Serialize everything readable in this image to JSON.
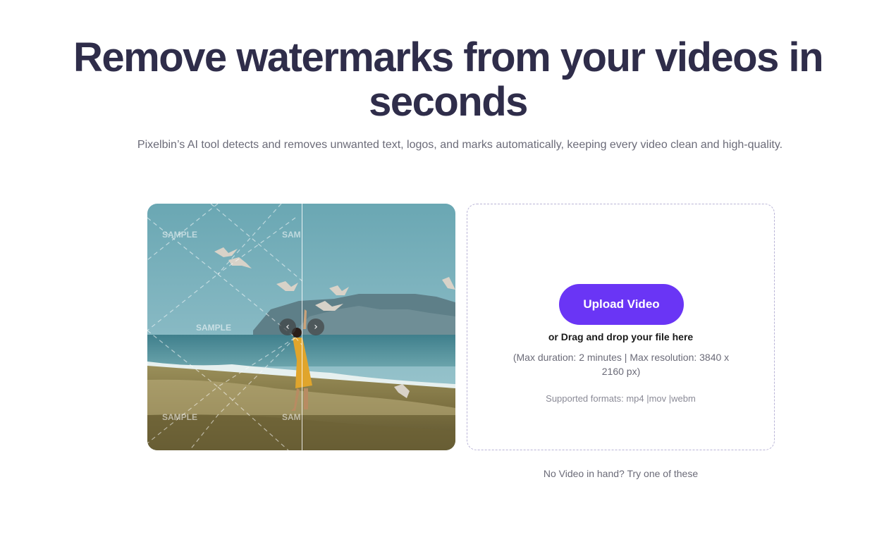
{
  "hero": {
    "title": "Remove watermarks from your videos in seconds",
    "subtitle": "Pixelbin’s AI tool detects and removes unwanted text, logos, and marks automatically, keeping every video clean and high-quality."
  },
  "comparison": {
    "watermark_text": "SAMPLE",
    "watermark_text_cut": "SAM",
    "prev_icon": "chevron-left-icon",
    "next_icon": "chevron-right-icon"
  },
  "upload": {
    "button_label": "Upload Video",
    "drag_text": "or Drag and drop your file here",
    "limits_text": "(Max duration: 2 minutes | Max resolution: 3840 x 2160 px)",
    "formats_text": "Supported formats: mp4 |mov |webm",
    "accent_color": "#6a35f5"
  },
  "samples": {
    "prompt": "No Video in hand? Try one of these"
  }
}
